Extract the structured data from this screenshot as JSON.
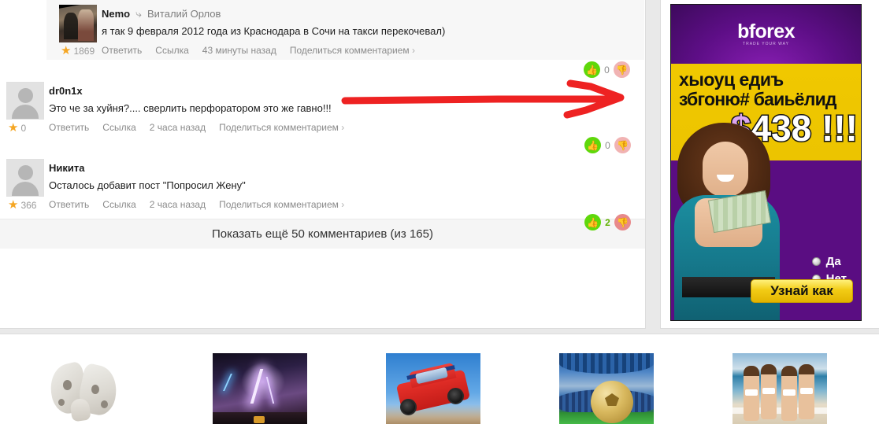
{
  "comments": [
    {
      "author": "Nemo",
      "reply_icon": "reply-arrow-icon",
      "reply_to": "Виталий Орлов",
      "text": "я так 9 февраля 2012 года из Краснодара в Сочи на такси перекочевал)",
      "rating": "1869",
      "star_icon": "star-icon",
      "avatar_type": "photo",
      "nested": true,
      "actions": {
        "reply": "Ответить",
        "link": "Ссылка",
        "time": "43 минуты назад",
        "share": "Поделиться комментарием"
      },
      "votes": {
        "up_icon": "thumbs-up-icon",
        "down_icon": "thumbs-down-icon",
        "count": "0",
        "voted": false
      }
    },
    {
      "author": "dr0n1x",
      "reply_icon": "",
      "reply_to": "",
      "text": "Это че за хуйня?.... сверлить перфоратором это же гавно!!!",
      "rating": "0",
      "star_icon": "star-icon",
      "avatar_type": "silhouette",
      "nested": false,
      "actions": {
        "reply": "Ответить",
        "link": "Ссылка",
        "time": "2 часа назад",
        "share": "Поделиться комментарием"
      },
      "votes": {
        "up_icon": "thumbs-up-icon",
        "down_icon": "thumbs-down-icon",
        "count": "0",
        "voted": false
      }
    },
    {
      "author": "Никита",
      "reply_icon": "",
      "reply_to": "",
      "text": "Осталось добавит пост \"Попросил Жену\"",
      "rating": "366",
      "star_icon": "star-icon",
      "avatar_type": "silhouette",
      "nested": false,
      "actions": {
        "reply": "Ответить",
        "link": "Ссылка",
        "time": "2 часа назад",
        "share": "Поделиться комментарием"
      },
      "votes": {
        "up_icon": "thumbs-up-icon",
        "down_icon": "thumbs-down-icon",
        "count": "2",
        "voted": true
      }
    }
  ],
  "show_more": "Показать ещё 50 комментариев (из 165)",
  "annotation": {
    "type": "red-arrow",
    "color": "#ee2222",
    "direction": "right"
  },
  "ad": {
    "logo_text": "bforex",
    "logo_tagline": "TRADE YOUR WAY",
    "headline_line1": "хыоуц едиъ",
    "headline_line2": "збгоню# баиьёлид",
    "price_currency": "$",
    "price_value": "438 !!!",
    "options": [
      {
        "label": "Да",
        "icon": "radio-button-icon"
      },
      {
        "label": "Нет",
        "icon": "radio-button-icon"
      }
    ],
    "cta_label": "Узнай как",
    "colors": {
      "purple": "#5a0d82",
      "yellow": "#ecc400",
      "cta": "#f2cc15"
    }
  },
  "thumbnails": [
    {
      "name": "moth-thumbnail"
    },
    {
      "name": "lightning-storm-thumbnail"
    },
    {
      "name": "red-rally-car-thumbnail"
    },
    {
      "name": "football-stadium-thumbnail"
    },
    {
      "name": "beach-girls-thumbnail"
    }
  ]
}
